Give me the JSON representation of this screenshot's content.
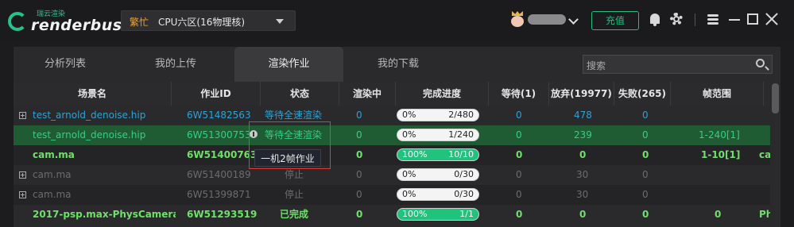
{
  "app": {
    "logo_small": "瑞云渲染",
    "logo_text": "renderbus",
    "zone_status": "繁忙",
    "zone_name": "CPU六区(16物理核)",
    "recharge_label": "充值"
  },
  "tabs": [
    {
      "label": "分析列表",
      "active": false
    },
    {
      "label": "我的上传",
      "active": false
    },
    {
      "label": "渲染作业",
      "active": true
    },
    {
      "label": "我的下载",
      "active": false
    }
  ],
  "search": {
    "placeholder": "搜索"
  },
  "columns": [
    "场景名",
    "作业ID",
    "状态",
    "渲染中",
    "完成进度",
    "等待(1)",
    "放弃(19977)",
    "失败(265)",
    "帧范围"
  ],
  "rows": [
    {
      "expand": true,
      "scene": "test_arnold_denoise.hip",
      "job_id": "6W51482563",
      "status": "等待全速渲染",
      "rendering": "0",
      "percent": "0%",
      "count": "2/480",
      "progress": 0,
      "waiting": "0",
      "abandoned": "478",
      "failed": "0",
      "frame_range": "",
      "extra": ""
    },
    {
      "expand": false,
      "scene": "test_arnold_denoise.hip",
      "job_id": "6W51300753",
      "status": "等待全速渲染",
      "rendering": "0",
      "percent": "0%",
      "count": "1/240",
      "progress": 0,
      "waiting": "0",
      "abandoned": "239",
      "failed": "0",
      "frame_range": "1-240[1]",
      "extra": ""
    },
    {
      "expand": false,
      "scene": "cam.ma",
      "job_id": "6W51400763",
      "status": "",
      "rendering": "0",
      "percent": "100%",
      "count": "10/10",
      "progress": 100,
      "waiting": "0",
      "abandoned": "0",
      "failed": "0",
      "frame_range": "1-10[1]",
      "extra": "cam"
    },
    {
      "expand": true,
      "scene": "cam.ma",
      "job_id": "6W51400189",
      "status": "停止",
      "rendering": "0",
      "percent": "0%",
      "count": "0/30",
      "progress": 0,
      "waiting": "0",
      "abandoned": "30",
      "failed": "0",
      "frame_range": "",
      "extra": ""
    },
    {
      "expand": true,
      "scene": "cam.ma",
      "job_id": "6W51399871",
      "status": "停止",
      "rendering": "0",
      "percent": "0%",
      "count": "0/30",
      "progress": 0,
      "waiting": "0",
      "abandoned": "30",
      "failed": "0",
      "frame_range": "",
      "extra": ""
    },
    {
      "expand": false,
      "scene": "2017-psp.max-PhysCamera...",
      "job_id": "6W51293519",
      "status": "已完成",
      "rendering": "0",
      "percent": "100%",
      "count": "1/1",
      "progress": 100,
      "waiting": "0",
      "abandoned": "0",
      "failed": "0",
      "frame_range": "0",
      "extra": "Phy"
    }
  ],
  "tooltip": {
    "text": "一机2帧作业"
  },
  "colors": {
    "accent": "#21c27c",
    "busy": "#e8a33a",
    "link": "#2aa3d6",
    "selected_row": "#1f5c33"
  }
}
